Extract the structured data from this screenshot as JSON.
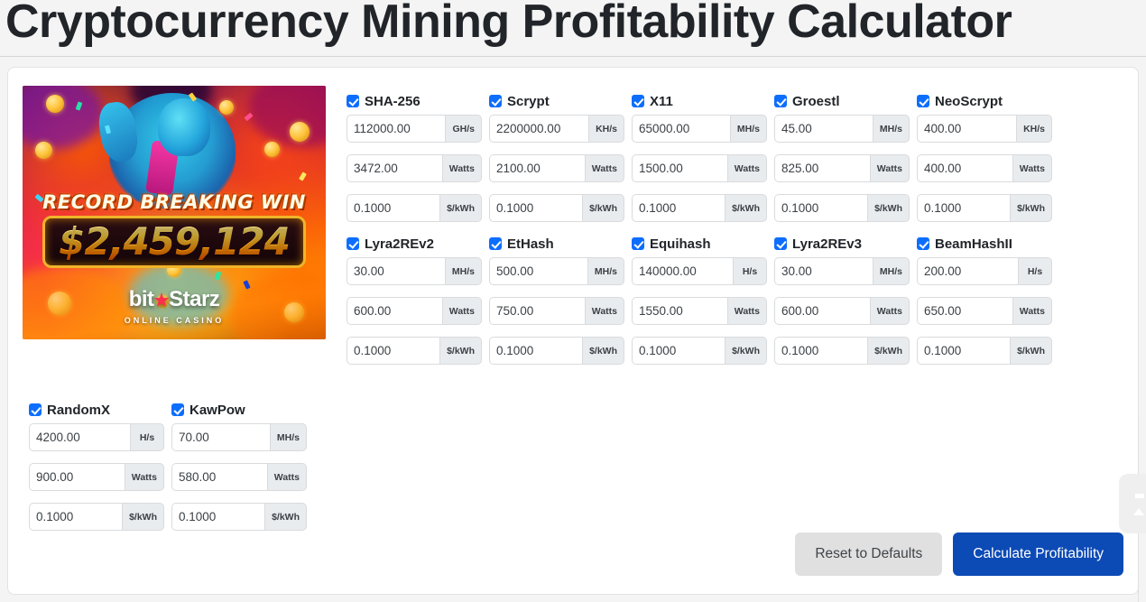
{
  "header": {
    "title": "Cryptocurrency Mining Profitability Calculator"
  },
  "ad": {
    "headline": "RECORD BREAKING WIN",
    "amount": "$2,459,124",
    "brand_left": "bit",
    "brand_star": "★",
    "brand_right": "Starz",
    "brand_sub": "ONLINE CASINO"
  },
  "units": {
    "watts": "Watts",
    "cost": "$/kWh"
  },
  "algorithms_top": [
    {
      "name": "SHA-256",
      "checked": true,
      "hashrate": "112000.00",
      "hashrate_unit": "GH/s",
      "power": "3472.00",
      "power_unit": "Watts",
      "cost": "0.1000",
      "cost_unit": "$/kWh"
    },
    {
      "name": "Scrypt",
      "checked": true,
      "hashrate": "2200000.00",
      "hashrate_unit": "KH/s",
      "power": "2100.00",
      "power_unit": "Watts",
      "cost": "0.1000",
      "cost_unit": "$/kWh"
    },
    {
      "name": "X11",
      "checked": true,
      "hashrate": "65000.00",
      "hashrate_unit": "MH/s",
      "power": "1500.00",
      "power_unit": "Watts",
      "cost": "0.1000",
      "cost_unit": "$/kWh"
    },
    {
      "name": "Groestl",
      "checked": true,
      "hashrate": "45.00",
      "hashrate_unit": "MH/s",
      "power": "825.00",
      "power_unit": "Watts",
      "cost": "0.1000",
      "cost_unit": "$/kWh"
    },
    {
      "name": "NeoScrypt",
      "checked": true,
      "hashrate": "400.00",
      "hashrate_unit": "KH/s",
      "power": "400.00",
      "power_unit": "Watts",
      "cost": "0.1000",
      "cost_unit": "$/kWh"
    },
    {
      "name": "Lyra2REv2",
      "checked": true,
      "hashrate": "30.00",
      "hashrate_unit": "MH/s",
      "power": "600.00",
      "power_unit": "Watts",
      "cost": "0.1000",
      "cost_unit": "$/kWh"
    },
    {
      "name": "EtHash",
      "checked": true,
      "hashrate": "500.00",
      "hashrate_unit": "MH/s",
      "power": "750.00",
      "power_unit": "Watts",
      "cost": "0.1000",
      "cost_unit": "$/kWh"
    },
    {
      "name": "Equihash",
      "checked": true,
      "hashrate": "140000.00",
      "hashrate_unit": "H/s",
      "power": "1550.00",
      "power_unit": "Watts",
      "cost": "0.1000",
      "cost_unit": "$/kWh"
    },
    {
      "name": "Lyra2REv3",
      "checked": true,
      "hashrate": "30.00",
      "hashrate_unit": "MH/s",
      "power": "600.00",
      "power_unit": "Watts",
      "cost": "0.1000",
      "cost_unit": "$/kWh"
    },
    {
      "name": "BeamHashII",
      "checked": true,
      "hashrate": "200.00",
      "hashrate_unit": "H/s",
      "power": "650.00",
      "power_unit": "Watts",
      "cost": "0.1000",
      "cost_unit": "$/kWh"
    }
  ],
  "algorithms_bottom": [
    {
      "name": "RandomX",
      "checked": true,
      "hashrate": "4200.00",
      "hashrate_unit": "H/s",
      "power": "900.00",
      "power_unit": "Watts",
      "cost": "0.1000",
      "cost_unit": "$/kWh"
    },
    {
      "name": "KawPow",
      "checked": true,
      "hashrate": "70.00",
      "hashrate_unit": "MH/s",
      "power": "580.00",
      "power_unit": "Watts",
      "cost": "0.1000",
      "cost_unit": "$/kWh"
    }
  ],
  "actions": {
    "reset_label": "Reset to Defaults",
    "calculate_label": "Calculate Profitability"
  },
  "colors": {
    "accent": "#0d6efd",
    "primary_button": "#0c4ab5",
    "secondary_button": "#e0e0e0",
    "addon_bg": "#e9ecef",
    "page_bg": "#f4f4f4"
  }
}
